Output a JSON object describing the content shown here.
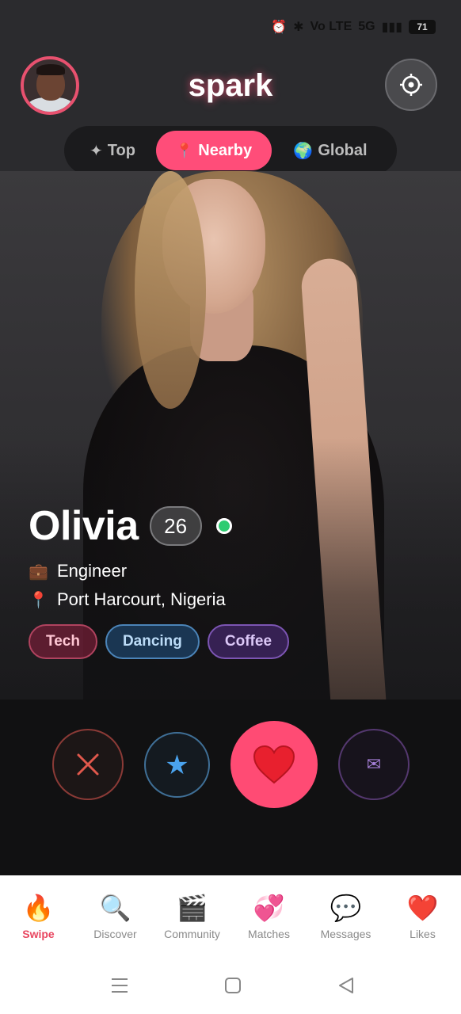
{
  "status_bar": {
    "network": "Vo LTE",
    "signal": "5G",
    "battery": "71"
  },
  "header": {
    "brand": "spark"
  },
  "tabs": [
    {
      "icon": "✦",
      "label": "Top"
    },
    {
      "icon": "📍",
      "label": "Nearby"
    },
    {
      "icon": "🌍",
      "label": "Global"
    }
  ],
  "profile": {
    "name": "Olivia",
    "age": "26",
    "job_icon": "💼",
    "job": "Engineer",
    "location_icon": "📍",
    "location": "Port Harcourt, Nigeria",
    "interests": [
      "Tech",
      "Dancing",
      "Coffee"
    ]
  },
  "actions": {
    "star_glyph": "★",
    "message_glyph": "✉"
  },
  "nav": [
    {
      "icon": "🔥",
      "label": "Swipe"
    },
    {
      "icon": "🔍",
      "label": "Discover"
    },
    {
      "icon": "🎬",
      "label": "Community"
    },
    {
      "icon": "💞",
      "label": "Matches"
    },
    {
      "icon": "💬",
      "label": "Messages"
    },
    {
      "icon": "❤️",
      "label": "Likes"
    }
  ],
  "colors": {
    "accent": "#ff4d79",
    "online": "#2ecc71",
    "active_nav": "#e8455f"
  }
}
